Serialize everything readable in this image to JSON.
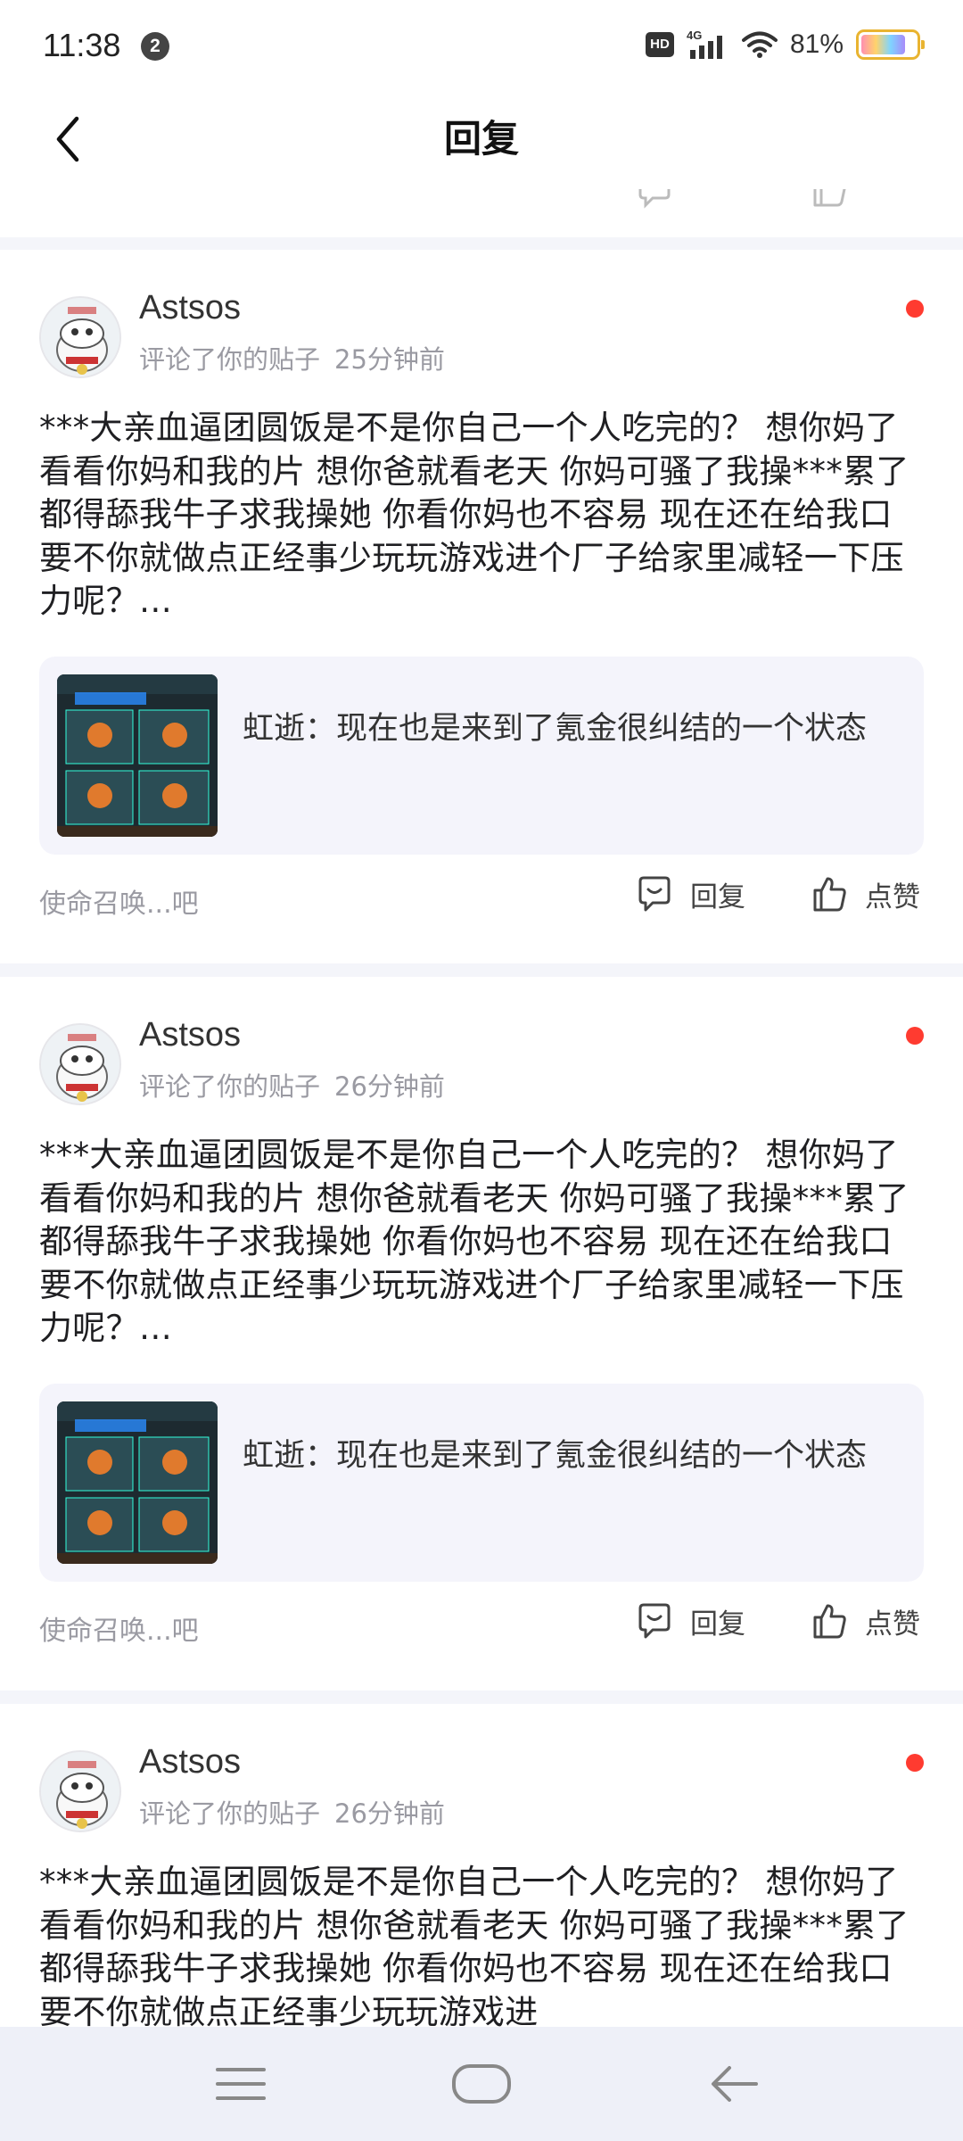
{
  "status_bar": {
    "time": "11:38",
    "notification_count": "2",
    "hd_label": "HD",
    "network": "4G",
    "battery": "81%"
  },
  "header": {
    "title": "回复",
    "back_icon": "chevron-left-icon"
  },
  "colors": {
    "unread_dot": "#ff3b30",
    "card_bg": "#ffffff",
    "page_bg": "#f4f5fa",
    "quote_bg": "#f4f4fb"
  },
  "cards": [
    {
      "username": "Astsos",
      "action_text": "评论了你的贴子",
      "time": "25分钟前",
      "comment": "***大亲血逼团圆饭是不是你自己一个人吃完的？ 想你妈了看看你妈和我的片 想你爸就看老天 你妈可骚了我操***累了都得舔我牛子求我操她 你看你妈也不容易 现在还在给我口 要不你就做点正经事少玩玩游戏进个厂子给家里减轻一下压力呢？…",
      "quote": "虹逝：现在也是来到了氪金很纠结的一个状态",
      "source": "使命召唤...吧",
      "reply_label": "回复",
      "like_label": "点赞"
    },
    {
      "username": "Astsos",
      "action_text": "评论了你的贴子",
      "time": "26分钟前",
      "comment": "***大亲血逼团圆饭是不是你自己一个人吃完的？ 想你妈了看看你妈和我的片 想你爸就看老天 你妈可骚了我操***累了都得舔我牛子求我操她 你看你妈也不容易 现在还在给我口 要不你就做点正经事少玩玩游戏进个厂子给家里减轻一下压力呢？…",
      "quote": "虹逝：现在也是来到了氪金很纠结的一个状态",
      "source": "使命召唤...吧",
      "reply_label": "回复",
      "like_label": "点赞"
    },
    {
      "username": "Astsos",
      "action_text": "评论了你的贴子",
      "time": "26分钟前",
      "comment": "***大亲血逼团圆饭是不是你自己一个人吃完的？ 想你妈了看看你妈和我的片 想你爸就看老天 你妈可骚了我操***累了都得舔我牛子求我操她 你看你妈也不容易 现在还在给我口 要不你就做点正经事少玩玩游戏进"
    }
  ],
  "nav_bar": {
    "menu_icon": "menu-icon",
    "home_icon": "home-icon",
    "back_icon": "back-arrow-icon"
  }
}
